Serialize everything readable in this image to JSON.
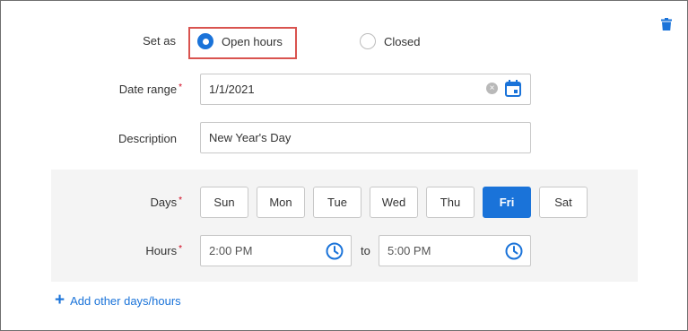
{
  "colors": {
    "accent": "#1a73d9",
    "highlight": "#d9534f",
    "required": "#d0021b"
  },
  "set_as": {
    "label": "Set as",
    "options": [
      {
        "label": "Open hours",
        "selected": true
      },
      {
        "label": "Closed",
        "selected": false
      }
    ]
  },
  "date_range": {
    "label": "Date range",
    "required_mark": "*",
    "value": "1/1/2021"
  },
  "description": {
    "label": "Description",
    "value": "New Year's Day"
  },
  "days": {
    "label": "Days",
    "required_mark": "*",
    "items": [
      {
        "label": "Sun",
        "active": false
      },
      {
        "label": "Mon",
        "active": false
      },
      {
        "label": "Tue",
        "active": false
      },
      {
        "label": "Wed",
        "active": false
      },
      {
        "label": "Thu",
        "active": false
      },
      {
        "label": "Fri",
        "active": true
      },
      {
        "label": "Sat",
        "active": false
      }
    ]
  },
  "hours": {
    "label": "Hours",
    "required_mark": "*",
    "start": "2:00 PM",
    "separator": "to",
    "end": "5:00 PM"
  },
  "add_link": {
    "label": "Add other days/hours",
    "icon": "plus-icon"
  },
  "icons": {
    "delete": "trash-icon",
    "calendar": "calendar-icon",
    "clear": "clear-icon",
    "clock": "clock-icon"
  }
}
